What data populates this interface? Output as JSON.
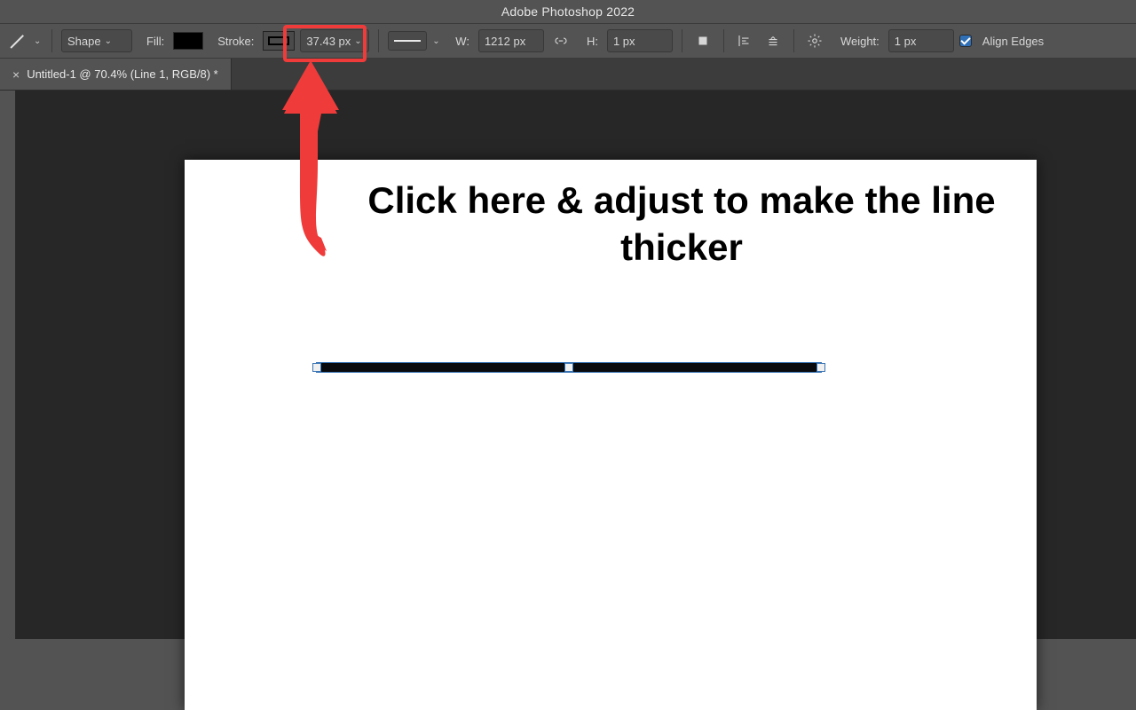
{
  "app": {
    "title": "Adobe Photoshop 2022"
  },
  "options": {
    "mode": "Shape",
    "fill_label": "Fill:",
    "stroke_label": "Stroke:",
    "stroke_width": "37.43 px",
    "W_label": "W:",
    "W_value": "1212 px",
    "H_label": "H:",
    "H_value": "1 px",
    "weight_label": "Weight:",
    "weight_value": "1 px",
    "align_edges_label": "Align Edges"
  },
  "document": {
    "tab_label": "Untitled-1 @ 70.4% (Line 1, RGB/8) *"
  },
  "annotation": {
    "text": "Click here & adjust to make the line thicker"
  },
  "colors": {
    "highlight": "#ef3b3a",
    "ui_bg": "#535353",
    "canvas_bg": "#272727",
    "selection": "#3a74b5"
  }
}
